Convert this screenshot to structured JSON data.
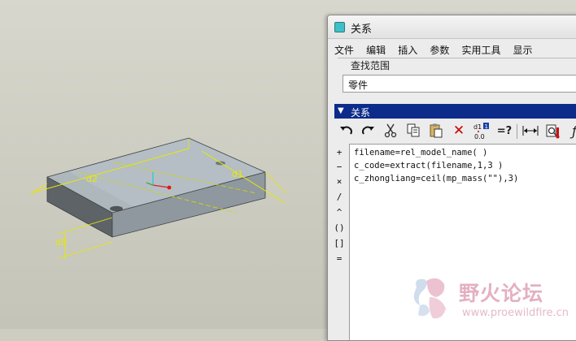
{
  "dialog": {
    "title": "关系",
    "menu": [
      "文件",
      "编辑",
      "插入",
      "参数",
      "实用工具",
      "显示"
    ],
    "scope_label": "查找范围",
    "scope_value": "零件",
    "section_title": "关系"
  },
  "toolbar": {
    "icons": [
      "undo-icon",
      "redo-icon",
      "cut-icon",
      "copy-icon",
      "paste-icon",
      "delete-icon",
      "toggle-units-icon",
      "evaluate-icon",
      "dimension-icon",
      "verify-icon",
      "function-icon"
    ],
    "units_top": "d1",
    "units_badge": "1",
    "units_bottom": "0.0",
    "evaluate_label": "=?"
  },
  "operators": [
    "+",
    "−",
    "×",
    "/",
    "^",
    "()",
    "[]",
    "="
  ],
  "relations": [
    "filename=rel_model_name( )",
    "c_code=extract(filename,1,3 )",
    "c_zhongliang=ceil(mp_mass(\"\"),3)"
  ],
  "model": {
    "dimensions": [
      "d2",
      "d1",
      "d0"
    ]
  },
  "watermark": {
    "title": "野火论坛",
    "url": "www.proewildfire.cn"
  },
  "colors": {
    "viewport": "#cdcdc2",
    "dimension": "#e8e800",
    "section_header": "#0c2b8a",
    "part_top": "#b6c0c6",
    "part_front": "#8a949a",
    "part_side": "#5e6468"
  }
}
